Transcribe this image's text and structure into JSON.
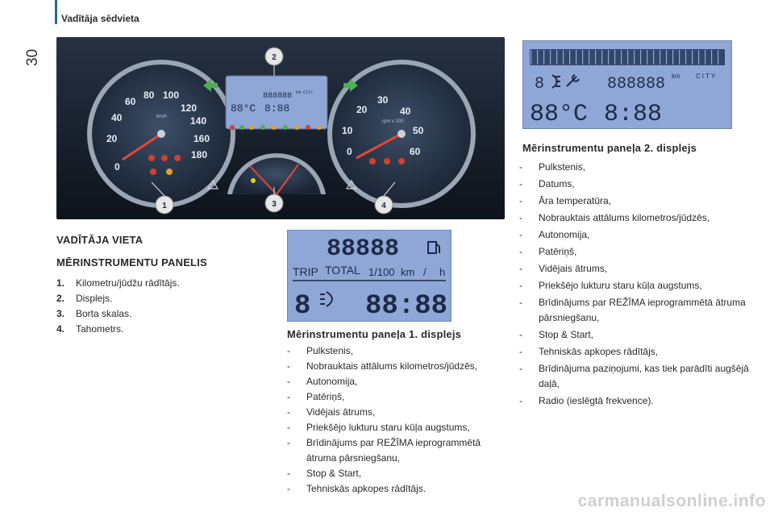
{
  "header": {
    "page_number": "30",
    "section_title": "Vadītāja sēdvieta"
  },
  "cluster": {
    "callouts": [
      "1",
      "2",
      "3",
      "4"
    ],
    "speedometer": {
      "ticks": [
        "0",
        "20",
        "40",
        "60",
        "80",
        "100",
        "120",
        "140",
        "160",
        "180"
      ],
      "unit": "km/h"
    },
    "tachometer": {
      "ticks": [
        "0",
        "10",
        "20",
        "30",
        "40",
        "50",
        "60"
      ],
      "unit": "rpm x 100"
    },
    "center_lcd": {
      "top": "888888",
      "unit": "km",
      "mode": "CITY",
      "temp": "88°C",
      "time": "8:88"
    }
  },
  "display2": {
    "odometer": "888888",
    "unit": "km",
    "mode": "CITY",
    "temperature": "88°C",
    "time": "8:88",
    "icons": [
      "headlamp-level-icon",
      "wrench-icon"
    ]
  },
  "display1": {
    "top_digits": "88888",
    "trip_label": "TRIP",
    "total_label": "TOTAL",
    "units": [
      "1/100",
      "km",
      "/",
      "h"
    ],
    "small_digit": "8",
    "time": "88:88",
    "icons": [
      "fuel-pump-icon",
      "headlamp-level-icon"
    ]
  },
  "main": {
    "title": "VADĪTĀJA VIETA",
    "subtitle": "MĒRINSTRUMENTU PANELIS",
    "items": [
      {
        "num": "1.",
        "text": "Kilometru/jūdžu rādītājs."
      },
      {
        "num": "2.",
        "text": "Displejs."
      },
      {
        "num": "3.",
        "text": "Borta skalas."
      },
      {
        "num": "4.",
        "text": "Tahometrs."
      }
    ]
  },
  "panel1": {
    "heading": "Mērinstrumentu paneļa 1. displejs",
    "items": [
      "Pulkstenis,",
      "Nobrauktais attālums kilometros/jūdzēs,",
      "Autonomija,",
      "Patēriņš,",
      "Vidējais ātrums,",
      "Priekšējo lukturu staru kūļa augstums,",
      "Brīdinājums par REŽĪMA ieprogrammētā ātruma pārsniegšanu,",
      "Stop & Start,",
      "Tehniskās apkopes rādītājs."
    ]
  },
  "panel2": {
    "heading": "Mērinstrumentu paneļa 2. displejs",
    "items": [
      "Pulkstenis,",
      "Datums,",
      "Āra temperatūra,",
      "Nobrauktais attālums kilometros/jūdzēs,",
      "Autonomija,",
      "Patēriņš,",
      "Vidējais ātrums,",
      "Priekšējo lukturu staru kūļa augstums,",
      "Brīdinājums par REŽĪMA ieprogrammētā ātruma pārsniegšanu,",
      "Stop & Start,",
      "Tehniskās apkopes rādītājs,",
      "Brīdinājuma paziņojumi, kas tiek parādīti augšējā daļā,",
      "Radio (ieslēgtā frekvence)."
    ]
  },
  "footer": {
    "watermark": "carmanualsonline.info"
  }
}
